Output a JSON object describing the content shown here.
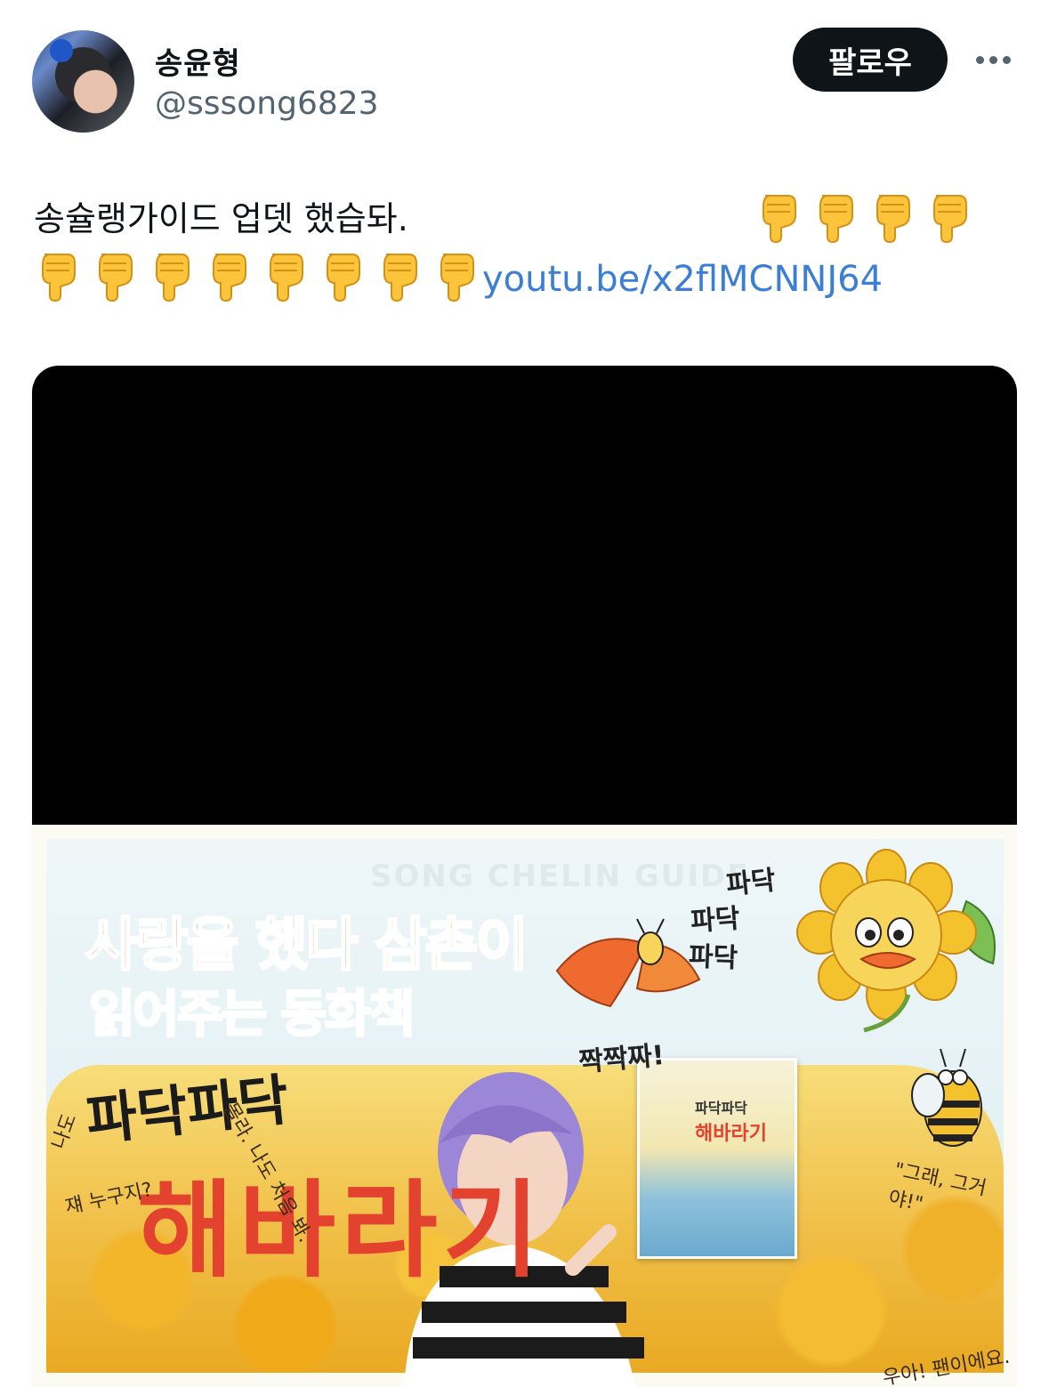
{
  "user": {
    "display_name": "송윤형",
    "handle": "@sssong6823",
    "follow_label": "팔로우"
  },
  "tweet": {
    "text": "송슐랭가이드 업뎃 했습돠.",
    "emoji_row1_count": 4,
    "emoji_row2_count": 8,
    "emoji": "pointing-down-hand",
    "link": "youtu.be/x2flMCNNJ64"
  },
  "thumbnail": {
    "watermark": "SONG CHELIN GUIDE",
    "title_line1_a": "사랑을 했다 ",
    "title_line1_b": "삼촌",
    "title_line1_c": "이",
    "title_line2": "읽어주는 동화책",
    "book_subtitle": "파닥파닥",
    "book_title": "해바라기",
    "sfx": [
      "파닥",
      "파닥",
      "파닥",
      "짝짝짜!"
    ],
    "bubbles": [
      "나도",
      "쟤 누구지?",
      "몰라. 나도 처음 봐.",
      "\"그래, 그거야!\"",
      "우아! 팬이에요."
    ],
    "book_cover_sub": "파닥파닥",
    "book_cover_title": "해바라기"
  },
  "colors": {
    "follow_bg": "#0f1419",
    "link": "#3b7ed6",
    "handle": "#536471",
    "title_orange": "#ef6a2e",
    "title_yellow": "#f6c837",
    "title_red": "#e3422e"
  }
}
